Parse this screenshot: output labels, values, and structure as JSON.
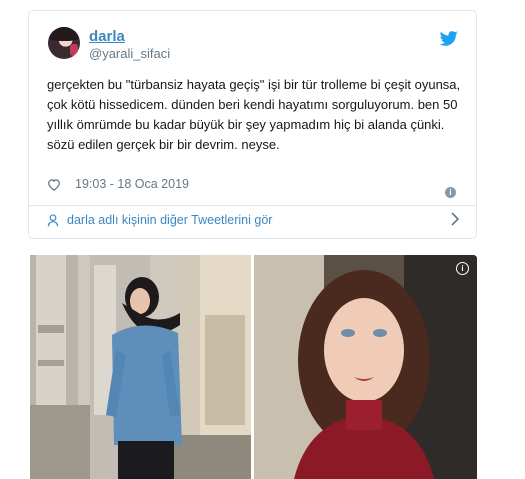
{
  "tweet": {
    "author_name": "darla",
    "author_handle": "@yarali_sifaci",
    "text": "gerçekten bu \"türbansiz hayata geçiş\" işi bir tür trolleme bi çeşit oyunsa, çok kötü hissedicem. dünden beri kendi hayatımı sorguluyorum. ben 50 yıllık ömrümde bu kadar büyük bir şey yapmadım hiç bi alanda çünki. sözü edilen gerçek bir bir devrim. neyse.",
    "timestamp": "19:03 - 18 Oca 2019",
    "more_tweets_link": "darla adlı kişinin diğer Tweetlerini gör"
  },
  "icons": {
    "brand": "twitter-bird-icon",
    "like": "heart-icon",
    "info": "info-icon",
    "user": "user-icon",
    "chevron": "chevron-right-icon"
  },
  "colors": {
    "link": "#3b88c3",
    "muted": "#657786",
    "border": "#e1e8ed",
    "twitter_blue": "#1da1f2"
  },
  "photos": {
    "left": "photo-hijab-denim",
    "right": "photo-selfie-red-sweater"
  }
}
